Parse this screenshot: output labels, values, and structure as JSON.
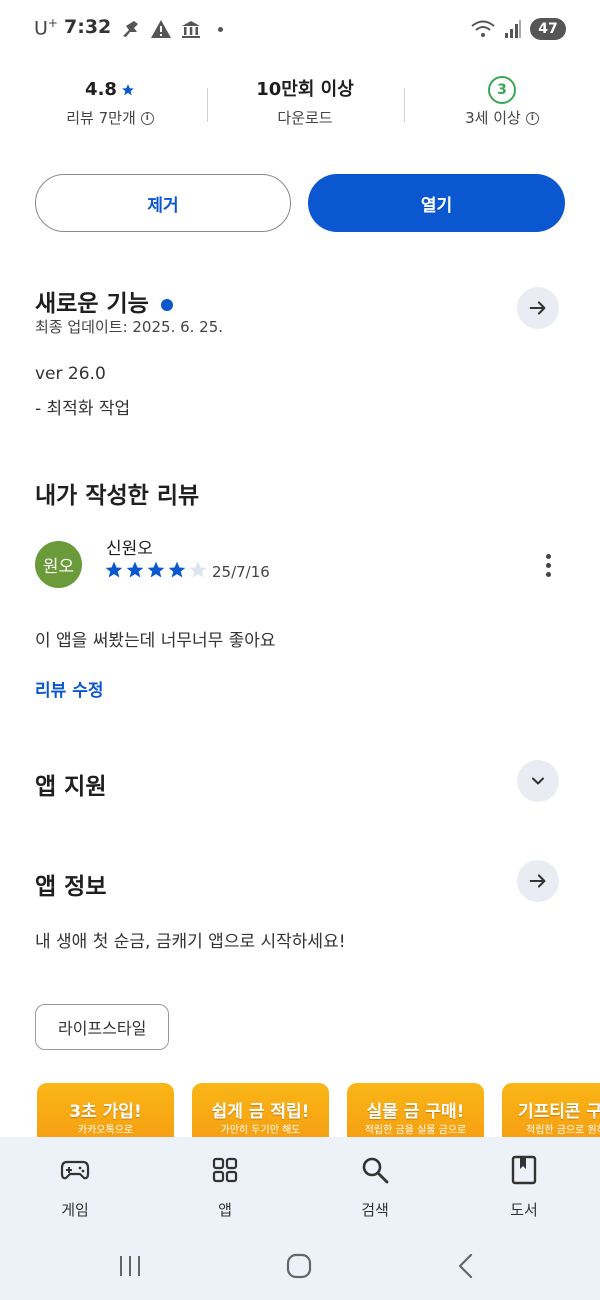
{
  "status_bar": {
    "carrier": "U",
    "carrier_sup": "+",
    "time": "7:32",
    "battery": "47"
  },
  "stats": {
    "rating": "4.8",
    "rating_label": "리뷰 7만개",
    "downloads": "10만회 이상",
    "downloads_label": "다운로드",
    "age": "3",
    "age_label": "3세 이상"
  },
  "actions": {
    "remove_label": "제거",
    "open_label": "열기"
  },
  "whats_new": {
    "title": "새로운 기능",
    "updated": "최종 업데이트: 2025. 6. 25.",
    "version": "ver 26.0",
    "notes": "- 최적화 작업"
  },
  "my_review": {
    "title": "내가 작성한 리뷰",
    "avatar_text": "원오",
    "reviewer": "신원오",
    "stars": 4,
    "date": "25/7/16",
    "text": "이 앱을 써봤는데 너무너무 좋아요",
    "edit_label": "리뷰 수정"
  },
  "app_support": {
    "title": "앱 지원"
  },
  "app_info": {
    "title": "앱 정보",
    "description": "내 생애 첫 순금, 금캐기 앱으로 시작하세요!",
    "category_chip": "라이프스타일"
  },
  "screenshots": [
    {
      "title": "3초 가입!",
      "sub": "카카오톡으로"
    },
    {
      "title": "쉽게 금 적립!",
      "sub": "가만히 두기만 해도"
    },
    {
      "title": "실물 금 구매!",
      "sub": "적립한 금을 실물 금으로"
    },
    {
      "title": "기프티콘 구",
      "sub": "적립한 금으로 원하"
    }
  ],
  "bottom_nav": {
    "games": "게임",
    "apps": "앱",
    "search": "검색",
    "books": "도서"
  },
  "colors": {
    "accent": "#0b57d0",
    "age_green": "#3aa757",
    "avatar_green": "#6a9a3a",
    "nav_bg": "#edf1f8"
  }
}
